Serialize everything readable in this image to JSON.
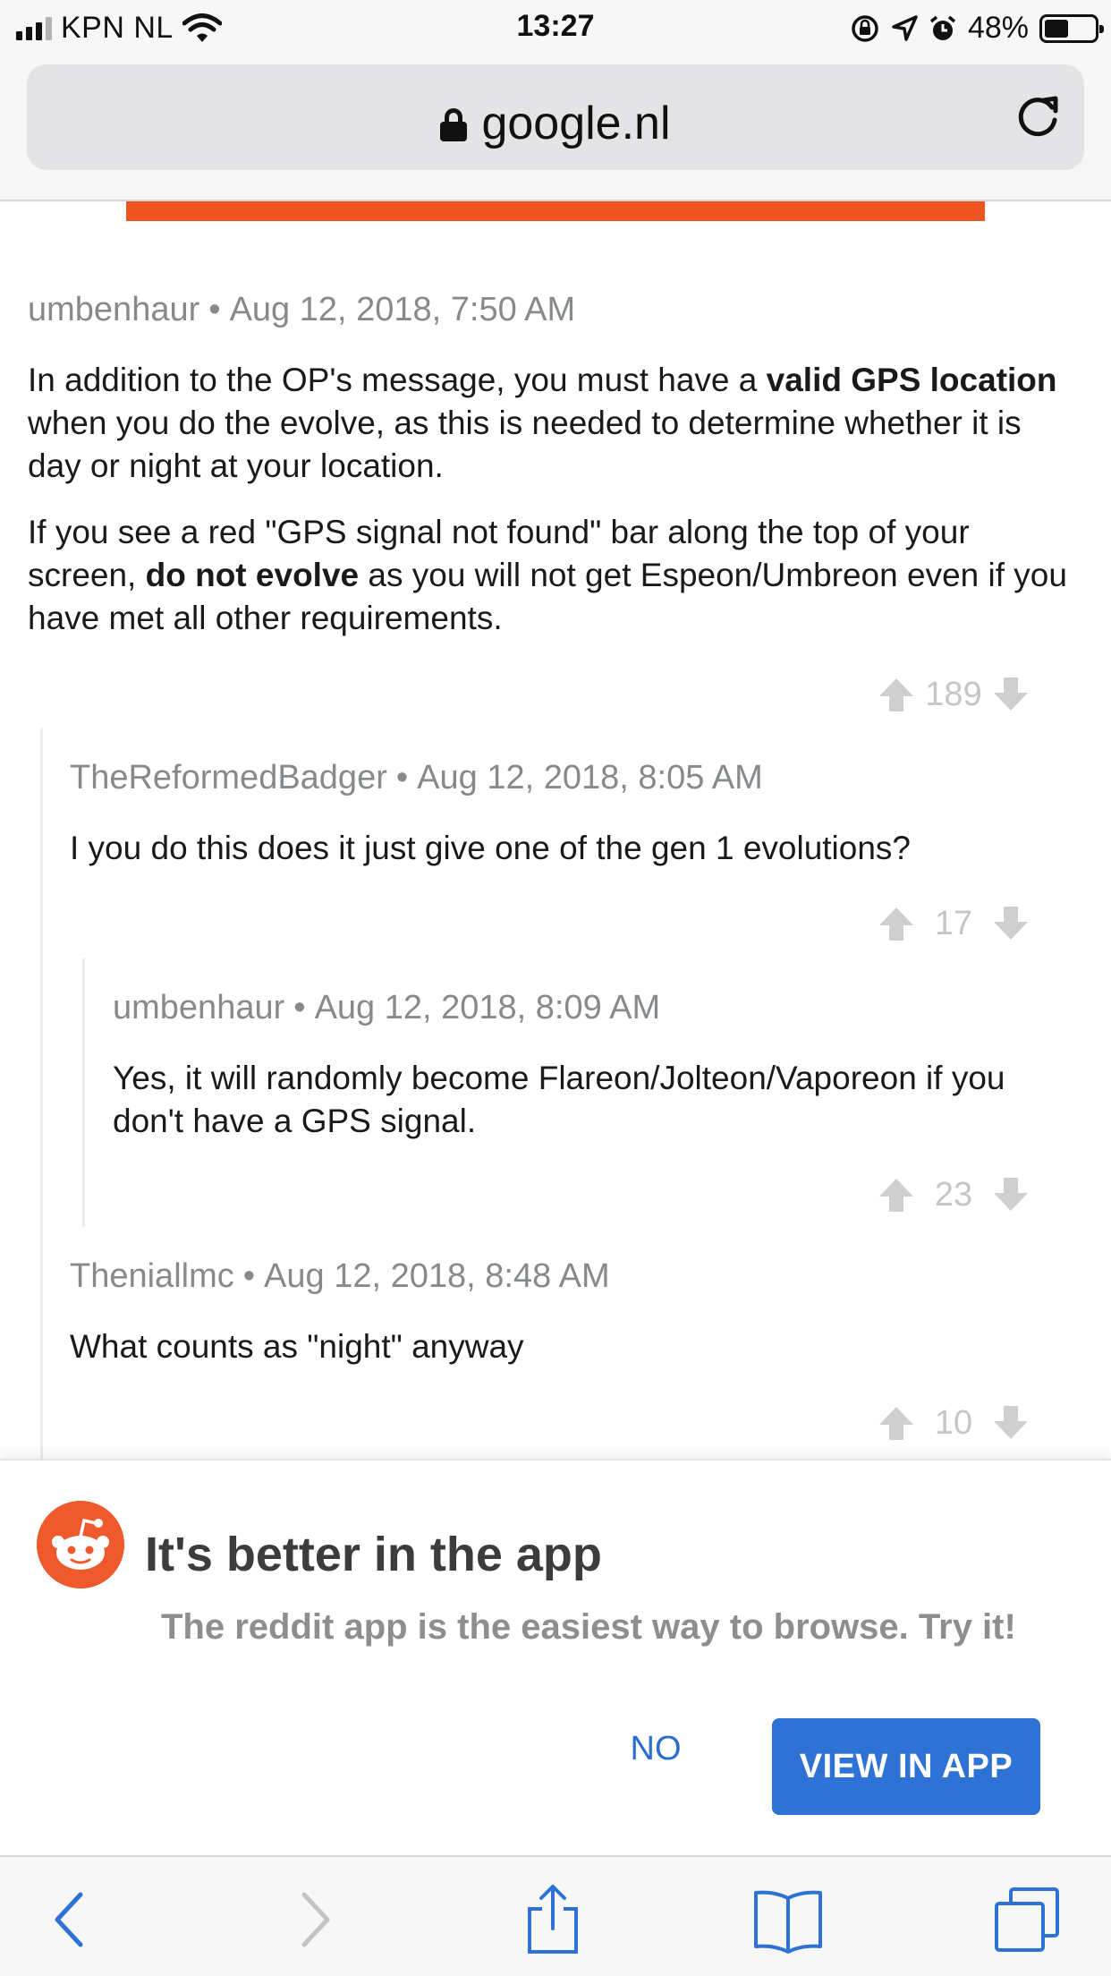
{
  "status_bar": {
    "carrier": "KPN NL",
    "time": "13:27",
    "battery": "48%",
    "battery_level": 0.48
  },
  "browser": {
    "url": "google.nl"
  },
  "comments": [
    {
      "author": "umbenhaur",
      "date": "Aug 12, 2018, 7:50 AM",
      "paragraphs": [
        {
          "t1": "In addition to the OP's message, you must have a ",
          "b1": "valid GPS location",
          "t2": " when you do the evolve, as this is needed to determine whether it is day or night at your location."
        },
        {
          "t1": "If you see a red \"GPS signal not found\" bar along the top of your screen, ",
          "b1": "do not evolve",
          "t2": " as you will not get Espeon/Umbreon even if you have met all other requirements."
        }
      ],
      "score": "189"
    },
    {
      "author": "TheReformedBadger",
      "date": "Aug 12, 2018, 8:05 AM",
      "text": "I you do this does it just give one of the gen 1 evolutions?",
      "score": "17"
    },
    {
      "author": "umbenhaur",
      "date": "Aug 12, 2018, 8:09 AM",
      "text": "Yes, it will randomly become Flareon/Jolteon/Vaporeon if you don't have a GPS signal.",
      "score": "23"
    },
    {
      "author": "Theniallmc",
      "date": "Aug 12, 2018, 8:48 AM",
      "text": "What counts as \"night\" anyway",
      "score": "10"
    }
  ],
  "meta_separator": "•",
  "app_banner": {
    "title": "It's better in the app",
    "description": "The reddit app is the easiest way to browse. Try it!",
    "no_label": "NO",
    "view_label": "VIEW IN APP"
  },
  "colors": {
    "accent": "#2d72d4",
    "reddit_orange": "#ee5a2c",
    "meta_gray": "#878a8c"
  },
  "icons": [
    "signal-icon",
    "wifi-icon",
    "rotation-lock-icon",
    "location-icon",
    "alarm-icon",
    "battery-icon",
    "lock-icon",
    "reload-icon",
    "upvote-icon",
    "downvote-icon",
    "reddit-logo-icon",
    "back-icon",
    "forward-icon",
    "share-icon",
    "bookmarks-icon",
    "tabs-icon"
  ]
}
